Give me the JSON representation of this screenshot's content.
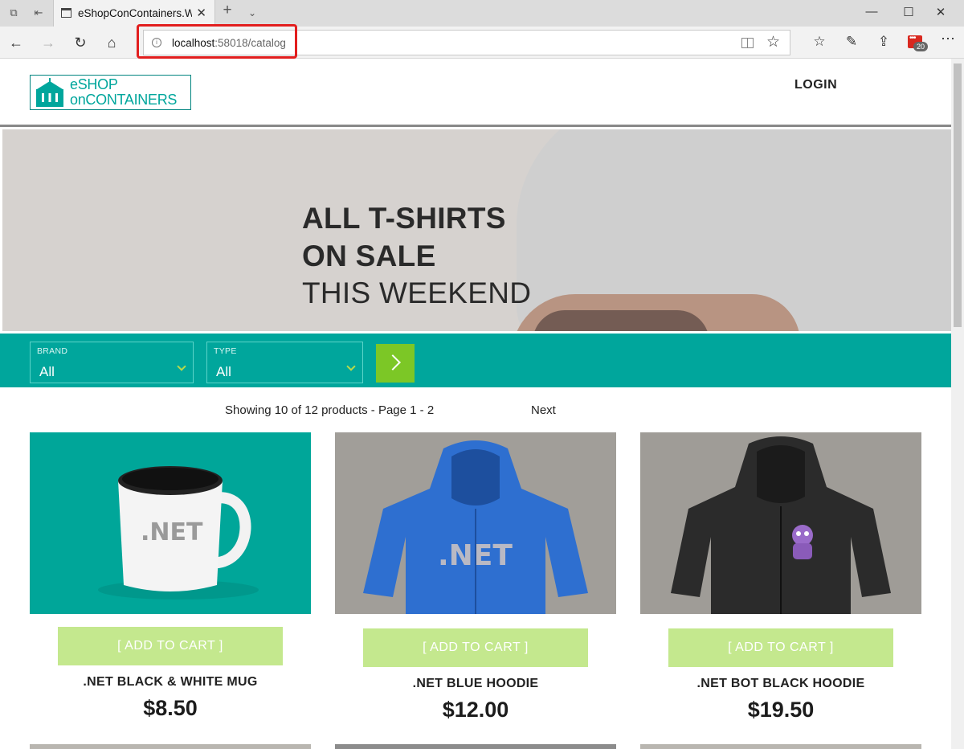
{
  "browser": {
    "tab_title": "eShopConContainers.W",
    "url_host": "localhost",
    "url_path": ":58018/catalog",
    "extension_badge": "20"
  },
  "site": {
    "logo_line1": "eSHOP",
    "logo_line2": "onCONTAINERS",
    "login_label": "LOGIN"
  },
  "hero": {
    "line1": "ALL T-SHIRTS",
    "line2": "ON SALE",
    "line3": "THIS WEEKEND"
  },
  "filters": {
    "brand": {
      "label": "BRAND",
      "value": "All"
    },
    "type": {
      "label": "TYPE",
      "value": "All"
    }
  },
  "pager": {
    "summary": "Showing 10 of 12 products - Page 1 - 2",
    "next_label": "Next"
  },
  "products": [
    {
      "name": ".NET BLACK & WHITE MUG",
      "price": "$8.50",
      "cart_label": "[ ADD TO CART ]",
      "image": "mug-image"
    },
    {
      "name": ".NET BLUE HOODIE",
      "price": "$12.00",
      "cart_label": "[ ADD TO CART ]",
      "image": "blue-hoodie-image"
    },
    {
      "name": ".NET BOT BLACK HOODIE",
      "price": "$19.50",
      "cart_label": "[ ADD TO CART ]",
      "image": "black-hoodie-image"
    }
  ],
  "colors": {
    "brand_teal": "#00a69c",
    "cart_button": "#c4e88e",
    "apply_button": "#7cc726",
    "highlight_box": "#e21e1e"
  },
  "icons": {
    "tabs": [
      "tab-preview-icon",
      "set-aside-tabs-icon",
      "new-tab-icon",
      "tab-list-chevron-icon"
    ],
    "window": [
      "minimize-icon",
      "maximize-icon",
      "close-window-icon"
    ],
    "nav": [
      "back-icon",
      "forward-icon",
      "refresh-icon",
      "home-icon"
    ],
    "toolbar": [
      "favorites-hub-icon",
      "web-note-icon",
      "share-icon",
      "extension-icon",
      "more-icon"
    ]
  }
}
